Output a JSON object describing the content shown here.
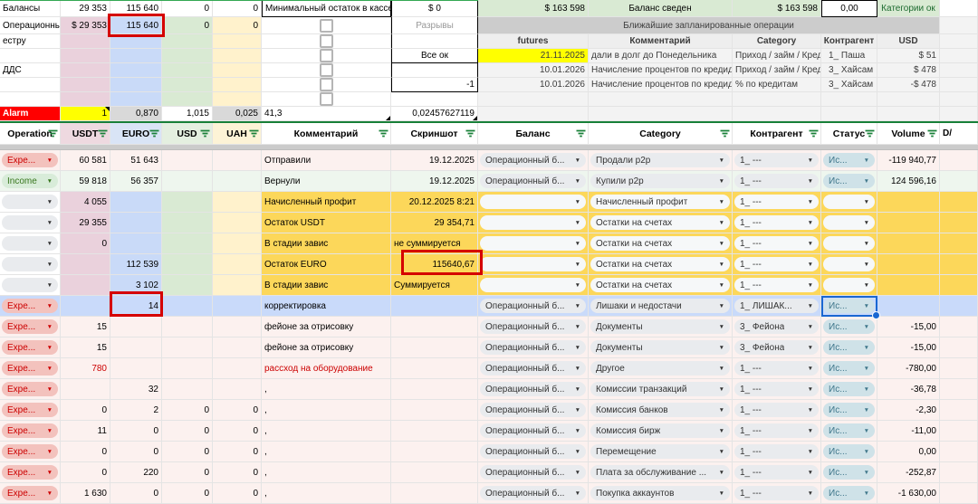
{
  "colors": {
    "col_pink": "#ead1dc",
    "col_blue": "#c9daf8",
    "col_green": "#d9ead3",
    "col_yellow": "#fff2cc",
    "hdr_pink": "#eed9e0",
    "hdr_blue": "#d9e4f6",
    "hdr_green": "#e4efe0",
    "hdr_yellow": "#fdf3d6",
    "row_pink": "#fcf1ef",
    "row_green": "#eef6ee",
    "row_gold": "#fcd75a",
    "row_blue": "#c9dafa",
    "alarm_red": "#ff0000",
    "alarm_yellow": "#ffff00",
    "cell_gray": "#d9d9d9",
    "planned_bg": "#f3f3f3",
    "planned_hdr_bg": "#eeeeee",
    "selection_blue": "#1967d2",
    "annotation_red": "#d50000",
    "divider_green": "#188038",
    "expense_red": "#cc0000",
    "income_green": "#38761d",
    "status_teal": "#41788c",
    "summary_green_text": "#1e6b30"
  },
  "top_left": {
    "labels": [
      "Балансы",
      "Операционны",
      "естру",
      "",
      "ДДС",
      "",
      "",
      "Alarm"
    ],
    "row_balances": {
      "usdt": "29 353",
      "euro": "115 640",
      "usd": "0",
      "uah": "0"
    },
    "row_operational": {
      "usdt": "$ 29 353",
      "euro": "115 640",
      "usd": "0",
      "uah": "0"
    },
    "kassa_label": "Минимальный остаток в кассе",
    "kassa_value": "$ 0",
    "status_box": [
      "Разрывы",
      "",
      "Все ок",
      "",
      "-1",
      ""
    ],
    "alarm": {
      "usdt": "1",
      "euro": "0,870",
      "usd": "1,015",
      "uah": "0,025",
      "comment": "41,3",
      "screenshot": "0,02457627119"
    }
  },
  "summary": {
    "total_left": "$ 163 598",
    "status": "Баланс сведен",
    "total_right": "$ 163 598",
    "delta": "0,00",
    "categories": "Категории ок"
  },
  "planned": {
    "title": "Ближайшие запланированные операции",
    "headers": [
      "futures",
      "Комментарий",
      "Category",
      "Контрагент",
      "USD"
    ],
    "rows": [
      {
        "date": "21.11.2025",
        "highlight": true,
        "comment": "дали в долг до Понедельника",
        "category": "Приход / займ / Кредит",
        "counterparty": "1_ Паша",
        "usd": "$ 51"
      },
      {
        "date": "10.01.2026",
        "highlight": false,
        "comment": "Начисление процентов по кредиди",
        "category": "Приход / займ / Кредит",
        "counterparty": "3_ Хайсам",
        "usd": "$ 478"
      },
      {
        "date": "10.01.2026",
        "highlight": false,
        "comment": "Начисление процентов по кредиди",
        "category": "% по кредитам",
        "counterparty": "3_ Хайсам",
        "usd": "-$ 478"
      }
    ]
  },
  "main_table": {
    "headers": [
      "Operation",
      "USDT",
      "EURO",
      "USD",
      "UAH",
      "Комментарий",
      "Скриншот",
      "Баланс",
      "Category",
      "Контрагент",
      "Статус",
      "Volume",
      "D/"
    ],
    "rows": [
      {
        "op": "Expe...",
        "opType": "expense",
        "usdt": "60 581",
        "euro": "51 643",
        "usd": "",
        "uah": "",
        "comment": "Отправили",
        "commentRed": false,
        "shot": "19.12.2025",
        "shotAlign": "r",
        "bal": "Операционный б...",
        "balType": "gray",
        "cat": "Продали p2p",
        "cp": "1_ ---",
        "status": "Ис...",
        "statusType": "status",
        "vol": "-119 940,77",
        "bg": "pink",
        "selected": false,
        "usdtRed": false
      },
      {
        "op": "Income",
        "opType": "income",
        "usdt": "59 818",
        "euro": "56 357",
        "usd": "",
        "uah": "",
        "comment": "Вернули",
        "commentRed": false,
        "shot": "19.12.2025",
        "shotAlign": "r",
        "bal": "Операционный б...",
        "balType": "gray",
        "cat": "Купили p2p",
        "cp": "1_ ---",
        "status": "Ис...",
        "statusType": "status",
        "vol": "124 596,16",
        "bg": "green",
        "selected": false,
        "usdtRed": false
      },
      {
        "op": "",
        "opType": "empty",
        "usdt": "4 055",
        "euro": "",
        "usd": "",
        "uah": "",
        "comment": "Начисленный профит",
        "commentRed": false,
        "shot": "20.12.2025 8:21",
        "shotAlign": "r",
        "bal": "",
        "balType": "empty",
        "cat": "Начисленный профит",
        "cp": "1_ ---",
        "status": "",
        "statusType": "empty",
        "vol": "",
        "bg": "gold",
        "selected": false,
        "usdtRed": false
      },
      {
        "op": "",
        "opType": "empty",
        "usdt": "29 355",
        "euro": "",
        "usd": "",
        "uah": "",
        "comment": "Остаток USDT",
        "commentRed": false,
        "shot": "29 354,71",
        "shotAlign": "r",
        "bal": "",
        "balType": "empty",
        "cat": "Остатки на счетах",
        "cp": "1_ ---",
        "status": "",
        "statusType": "empty",
        "vol": "",
        "bg": "gold",
        "selected": false,
        "usdtRed": false
      },
      {
        "op": "",
        "opType": "empty",
        "usdt": "0",
        "euro": "",
        "usd": "",
        "uah": "",
        "comment": "В стадии завис",
        "commentRed": false,
        "shot": "не суммируется",
        "shotAlign": "l",
        "bal": "",
        "balType": "empty",
        "cat": "Остатки на счетах",
        "cp": "1_ ---",
        "status": "",
        "statusType": "empty",
        "vol": "",
        "bg": "gold",
        "selected": false,
        "usdtRed": false
      },
      {
        "op": "",
        "opType": "empty",
        "usdt": "",
        "euro": "112 539",
        "usd": "",
        "uah": "",
        "comment": "Остаток EURO",
        "commentRed": false,
        "shot": "115640,67",
        "shotAlign": "r",
        "bal": "",
        "balType": "empty",
        "cat": "Остатки на счетах",
        "cp": "1_ ---",
        "status": "",
        "statusType": "empty",
        "vol": "",
        "bg": "gold",
        "selected": false,
        "usdtRed": false
      },
      {
        "op": "",
        "opType": "empty",
        "usdt": "",
        "euro": "3 102",
        "usd": "",
        "uah": "",
        "comment": "В стадии завис",
        "commentRed": false,
        "shot": "Суммируется",
        "shotAlign": "l",
        "bal": "",
        "balType": "empty",
        "cat": "Остатки на счетах",
        "cp": "1_ ---",
        "status": "",
        "statusType": "empty",
        "vol": "",
        "bg": "gold",
        "selected": false,
        "usdtRed": false
      },
      {
        "op": "Expe...",
        "opType": "expense",
        "usdt": "",
        "euro": "14",
        "usd": "",
        "uah": "",
        "comment": "корректировка",
        "commentRed": false,
        "shot": "",
        "shotAlign": "r",
        "bal": "Операционный б...",
        "balType": "gray",
        "cat": "Лишаки и недостачи",
        "cp": "1_ ЛИШАК...",
        "status": "Ис...",
        "statusType": "status",
        "vol": "",
        "bg": "blue",
        "selected": true,
        "usdtRed": false
      },
      {
        "op": "Expe...",
        "opType": "expense",
        "usdt": "15",
        "euro": "",
        "usd": "",
        "uah": "",
        "comment": "фейоне за отрисовку",
        "commentRed": false,
        "shot": "",
        "shotAlign": "r",
        "bal": "Операционный б...",
        "balType": "gray",
        "cat": "Документы",
        "cp": "3_ Фейона",
        "status": "Ис...",
        "statusType": "status",
        "vol": "-15,00",
        "bg": "pink",
        "selected": false,
        "usdtRed": false
      },
      {
        "op": "Expe...",
        "opType": "expense",
        "usdt": "15",
        "euro": "",
        "usd": "",
        "uah": "",
        "comment": "фейоне за отрисовку",
        "commentRed": false,
        "shot": "",
        "shotAlign": "r",
        "bal": "Операционный б...",
        "balType": "gray",
        "cat": "Документы",
        "cp": "3_ Фейона",
        "status": "Ис...",
        "statusType": "status",
        "vol": "-15,00",
        "bg": "pink",
        "selected": false,
        "usdtRed": false
      },
      {
        "op": "Expe...",
        "opType": "expense",
        "usdt": "780",
        "euro": "",
        "usd": "",
        "uah": "",
        "comment": "рассход на оборудование",
        "commentRed": true,
        "shot": "",
        "shotAlign": "r",
        "bal": "Операционный б...",
        "balType": "gray",
        "cat": "Другое",
        "cp": "1_ ---",
        "status": "Ис...",
        "statusType": "status",
        "vol": "-780,00",
        "bg": "pink",
        "selected": false,
        "usdtRed": true
      },
      {
        "op": "Expe...",
        "opType": "expense",
        "usdt": "",
        "euro": "32",
        "usd": "",
        "uah": "",
        "comment": ",",
        "commentRed": false,
        "shot": "",
        "shotAlign": "r",
        "bal": "Операционный б...",
        "balType": "gray",
        "cat": "Комиссии транзакций",
        "cp": "1_ ---",
        "status": "Ис...",
        "statusType": "status",
        "vol": "-36,78",
        "bg": "pink",
        "selected": false,
        "usdtRed": false
      },
      {
        "op": "Expe...",
        "opType": "expense",
        "usdt": "0",
        "euro": "2",
        "usd": "0",
        "uah": "0",
        "comment": ",",
        "commentRed": false,
        "shot": "",
        "shotAlign": "r",
        "bal": "Операционный б...",
        "balType": "gray",
        "cat": "Комиссия банков",
        "cp": "1_ ---",
        "status": "Ис...",
        "statusType": "status",
        "vol": "-2,30",
        "bg": "pink",
        "selected": false,
        "usdtRed": false
      },
      {
        "op": "Expe...",
        "opType": "expense",
        "usdt": "11",
        "euro": "0",
        "usd": "0",
        "uah": "0",
        "comment": ",",
        "commentRed": false,
        "shot": "",
        "shotAlign": "r",
        "bal": "Операционный б...",
        "balType": "gray",
        "cat": "Комиссия бирж",
        "cp": "1_ ---",
        "status": "Ис...",
        "statusType": "status",
        "vol": "-11,00",
        "bg": "pink",
        "selected": false,
        "usdtRed": false
      },
      {
        "op": "Expe...",
        "opType": "expense",
        "usdt": "0",
        "euro": "0",
        "usd": "0",
        "uah": "0",
        "comment": ",",
        "commentRed": false,
        "shot": "",
        "shotAlign": "r",
        "bal": "Операционный б...",
        "balType": "gray",
        "cat": "Перемещение",
        "cp": "1_ ---",
        "status": "Ис...",
        "statusType": "status",
        "vol": "0,00",
        "bg": "pink",
        "selected": false,
        "usdtRed": false
      },
      {
        "op": "Expe...",
        "opType": "expense",
        "usdt": "0",
        "euro": "220",
        "usd": "0",
        "uah": "0",
        "comment": ",",
        "commentRed": false,
        "shot": "",
        "shotAlign": "r",
        "bal": "Операционный б...",
        "balType": "gray",
        "cat": "Плата за обслуживание ...",
        "cp": "1_ ---",
        "status": "Ис...",
        "statusType": "status",
        "vol": "-252,87",
        "bg": "pink",
        "selected": false,
        "usdtRed": false
      },
      {
        "op": "Expe...",
        "opType": "expense",
        "usdt": "1 630",
        "euro": "0",
        "usd": "0",
        "uah": "0",
        "comment": ",",
        "commentRed": false,
        "shot": "",
        "shotAlign": "r",
        "bal": "Операционный б...",
        "balType": "gray",
        "cat": "Покупка аккаунтов",
        "cp": "1_ ---",
        "status": "Ис...",
        "statusType": "status",
        "vol": "-1 630,00",
        "bg": "pink",
        "selected": false,
        "usdtRed": false
      }
    ]
  }
}
